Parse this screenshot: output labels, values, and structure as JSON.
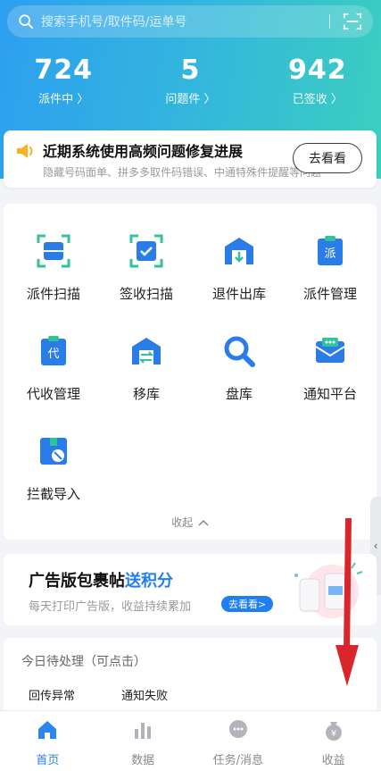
{
  "search": {
    "placeholder": "搜索手机号/取件码/运单号"
  },
  "stats": [
    {
      "value": "724",
      "label": "派件中 〉"
    },
    {
      "value": "5",
      "label": "问题件 〉"
    },
    {
      "value": "942",
      "label": "已签收 〉"
    }
  ],
  "notice": {
    "title": "近期系统使用高频问题修复进展",
    "subtitle": "隐藏号码面单、拼多多取件码错误、中通特殊件提醒等问题",
    "button": "去看看"
  },
  "grid": {
    "items": [
      {
        "label": "派件扫描",
        "icon": "dispatch-scan-icon"
      },
      {
        "label": "签收扫描",
        "icon": "sign-scan-icon"
      },
      {
        "label": "退件出库",
        "icon": "return-out-icon"
      },
      {
        "label": "派件管理",
        "icon": "dispatch-manage-icon"
      },
      {
        "label": "代收管理",
        "icon": "collect-manage-icon"
      },
      {
        "label": "移库",
        "icon": "move-stock-icon"
      },
      {
        "label": "盘库",
        "icon": "inventory-check-icon"
      },
      {
        "label": "通知平台",
        "icon": "notify-platform-icon"
      },
      {
        "label": "拦截导入",
        "icon": "intercept-import-icon"
      }
    ],
    "collapse": "收起"
  },
  "ad": {
    "title_prefix": "广告版包裹帖",
    "title_highlight": "送积分",
    "subtitle": "每天打印广告版，收益持续累加",
    "button": "去看看>"
  },
  "todo": {
    "header": "今日待处理（可点击）",
    "items": [
      "回传异常",
      "通知失败"
    ]
  },
  "tabbar": {
    "tabs": [
      {
        "label": "首页",
        "active": true
      },
      {
        "label": "数据",
        "active": false
      },
      {
        "label": "任务/消息",
        "active": false
      },
      {
        "label": "收益",
        "active": false
      }
    ]
  },
  "colors": {
    "primary": "#2a86f3",
    "hero_start": "#2e9ff0",
    "hero_end": "#3ccfbf",
    "accent_red": "#d9262b"
  }
}
